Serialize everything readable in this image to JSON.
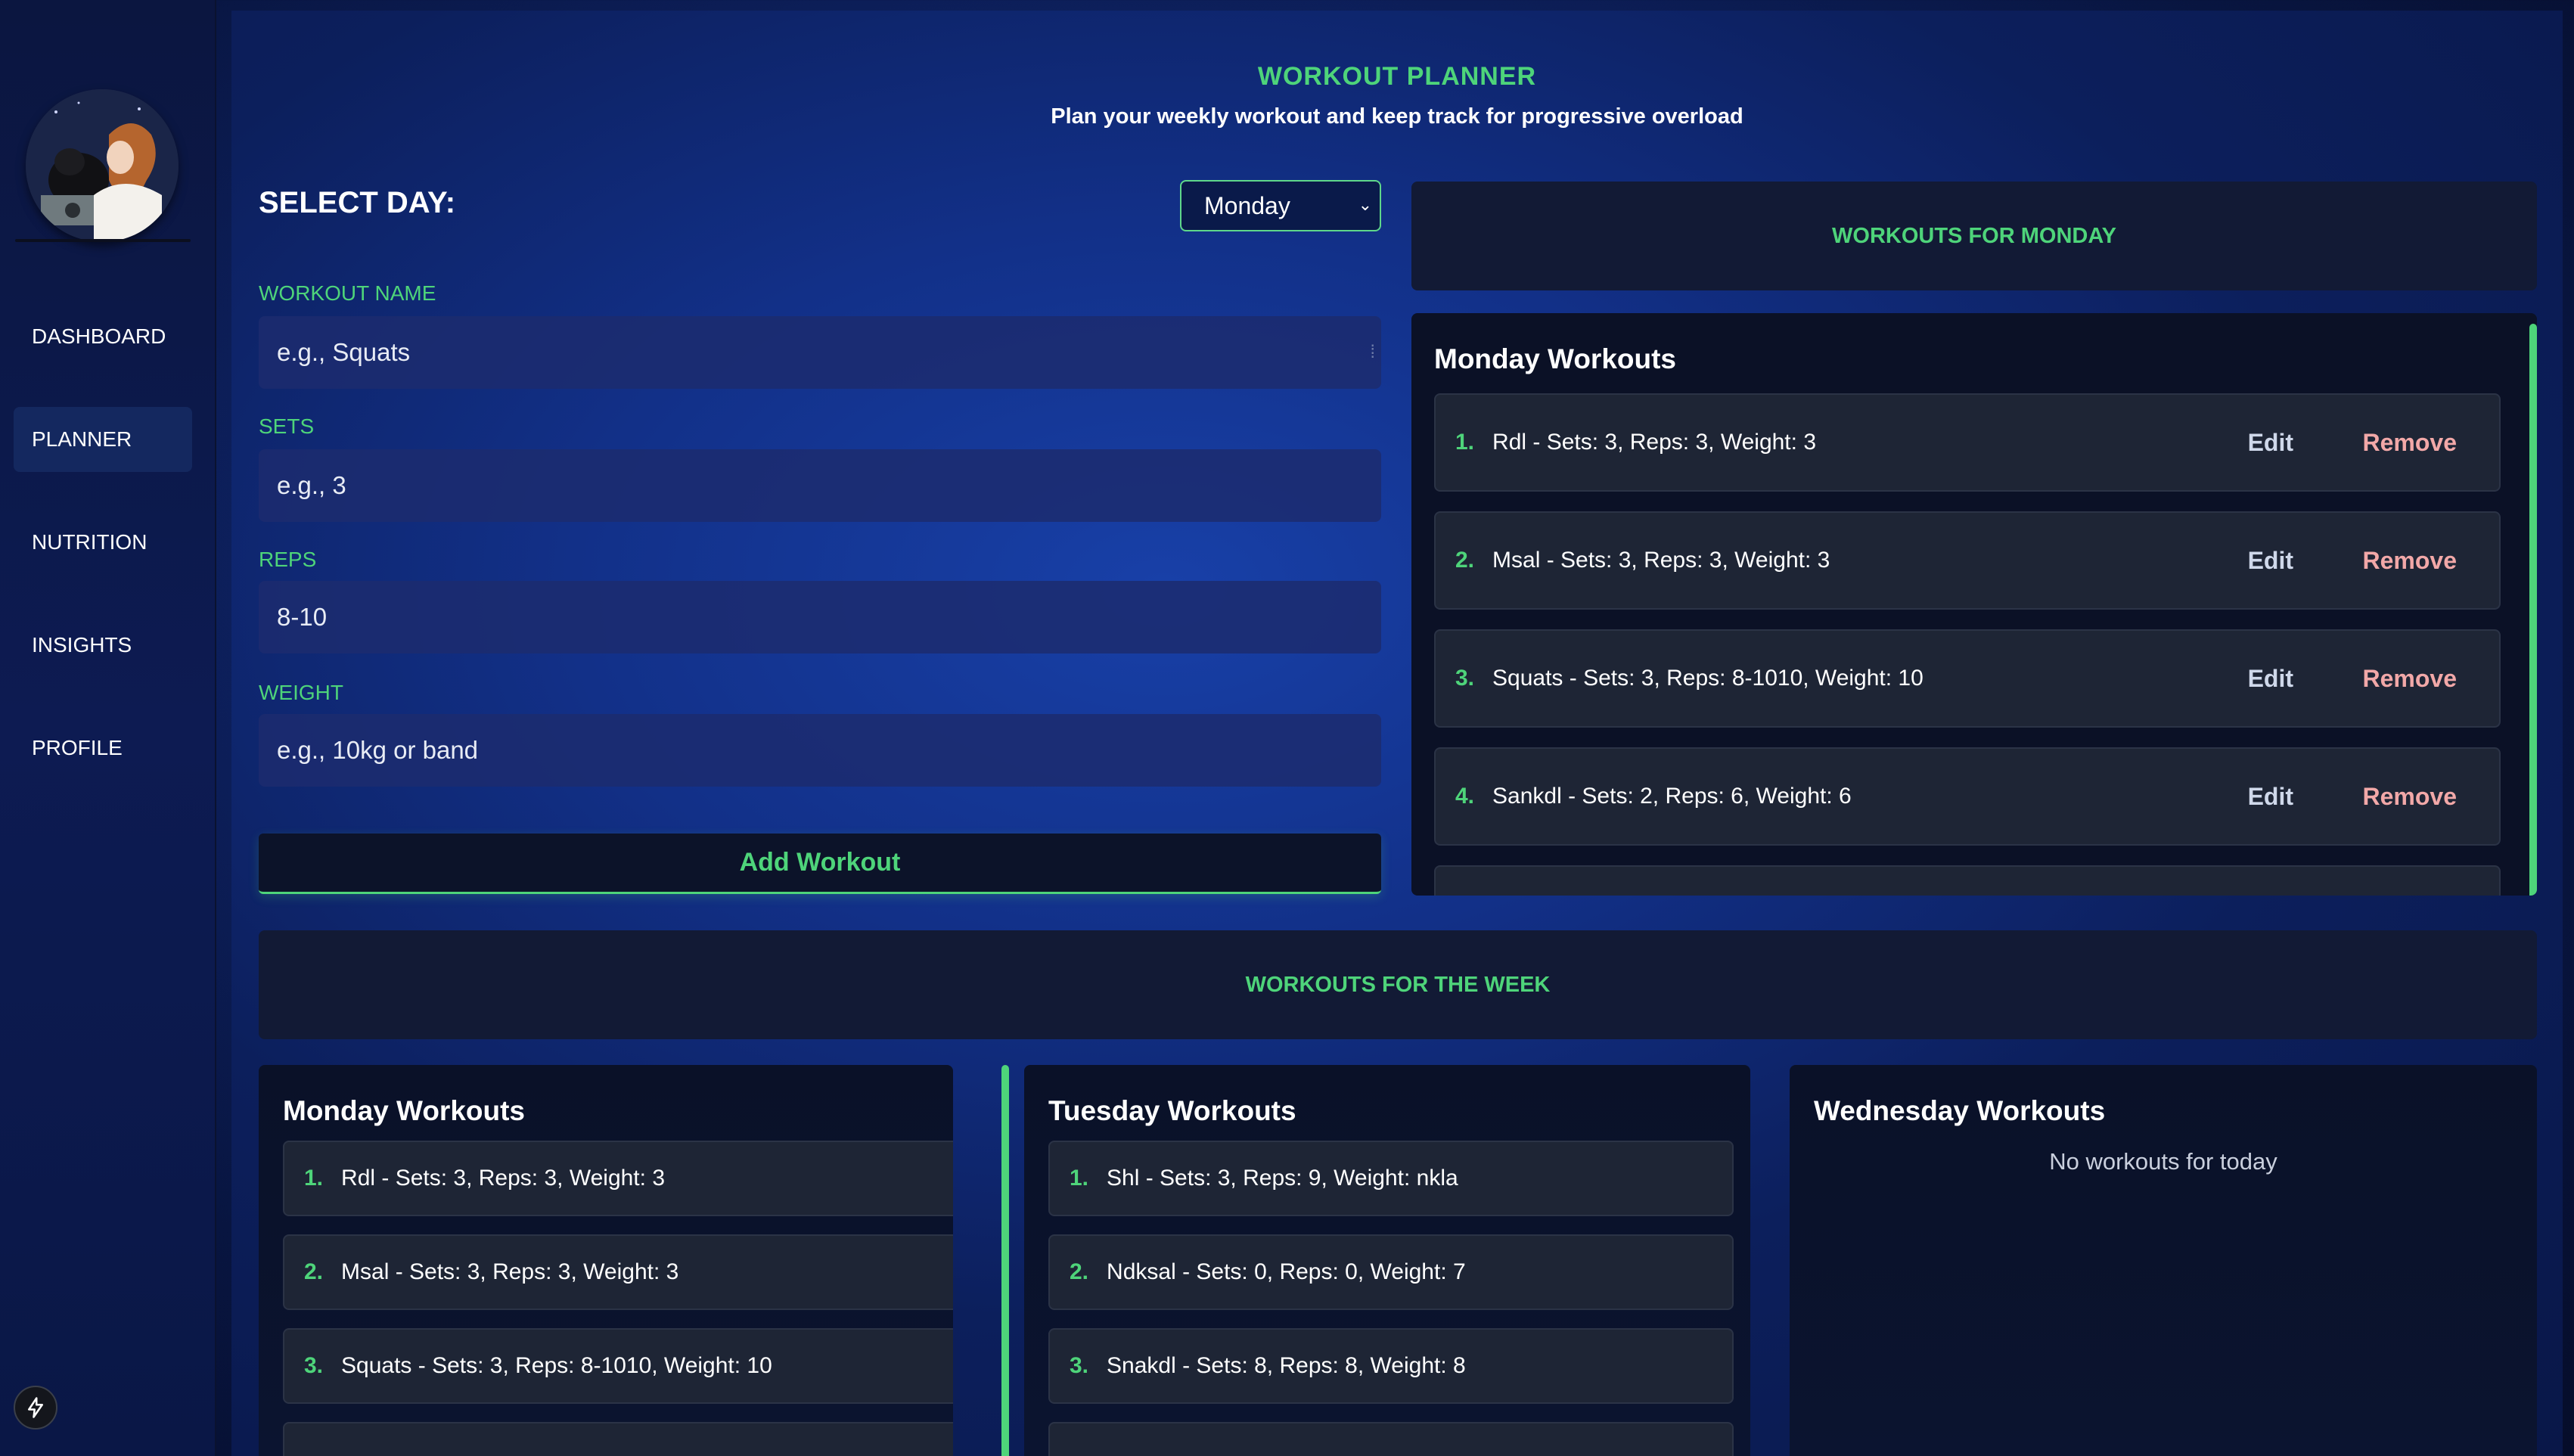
{
  "sidebar": {
    "avatar_alt": "User avatar",
    "items": [
      {
        "label": "DASHBOARD",
        "active": false
      },
      {
        "label": "PLANNER",
        "active": true
      },
      {
        "label": "NUTRITION",
        "active": false
      },
      {
        "label": "INSIGHTS",
        "active": false
      },
      {
        "label": "PROFILE",
        "active": false
      }
    ],
    "bolt_icon": "lightning-icon"
  },
  "header": {
    "title": "WORKOUT PLANNER",
    "subtitle": "Plan your weekly workout and keep track for progressive overload"
  },
  "form": {
    "select_day_label": "SELECT DAY:",
    "selected_day": "Monday",
    "workout_name": {
      "label": "WORKOUT NAME",
      "placeholder": "e.g., Squats"
    },
    "sets": {
      "label": "SETS",
      "placeholder": "e.g., 3"
    },
    "reps": {
      "label": "REPS",
      "value": "8-10"
    },
    "weight": {
      "label": "WEIGHT",
      "placeholder": "e.g., 10kg or band"
    },
    "add_button": "Add Workout"
  },
  "day_panel": {
    "header": "WORKOUTS FOR MONDAY",
    "title": "Monday Workouts",
    "edit_label": "Edit",
    "remove_label": "Remove",
    "items": [
      {
        "num": "1.",
        "text": "Rdl - Sets: 3, Reps: 3, Weight: 3"
      },
      {
        "num": "2.",
        "text": "Msal - Sets: 3, Reps: 3, Weight: 3"
      },
      {
        "num": "3.",
        "text": "Squats - Sets: 3, Reps: 8-1010, Weight: 10"
      },
      {
        "num": "4.",
        "text": "Sankdl - Sets: 2, Reps: 6, Weight: 6"
      }
    ]
  },
  "week": {
    "header": "WORKOUTS FOR THE WEEK",
    "days": [
      {
        "title": "Monday Workouts",
        "items": [
          {
            "num": "1.",
            "text": "Rdl - Sets: 3, Reps: 3, Weight: 3"
          },
          {
            "num": "2.",
            "text": "Msal - Sets: 3, Reps: 3, Weight: 3"
          },
          {
            "num": "3.",
            "text": "Squats - Sets: 3, Reps: 8-1010, Weight: 10"
          }
        ]
      },
      {
        "title": "Tuesday Workouts",
        "items": [
          {
            "num": "1.",
            "text": "Shl - Sets: 3, Reps: 9, Weight: nkla"
          },
          {
            "num": "2.",
            "text": "Ndksal - Sets: 0, Reps: 0, Weight: 7"
          },
          {
            "num": "3.",
            "text": "Snakdl - Sets: 8, Reps: 8, Weight: 8"
          }
        ]
      },
      {
        "title": "Wednesday Workouts",
        "empty_message": "No workouts for today"
      }
    ]
  },
  "colors": {
    "accent": "#4ed47a",
    "remove": "#f2a8a8",
    "panel": "#121a35"
  }
}
